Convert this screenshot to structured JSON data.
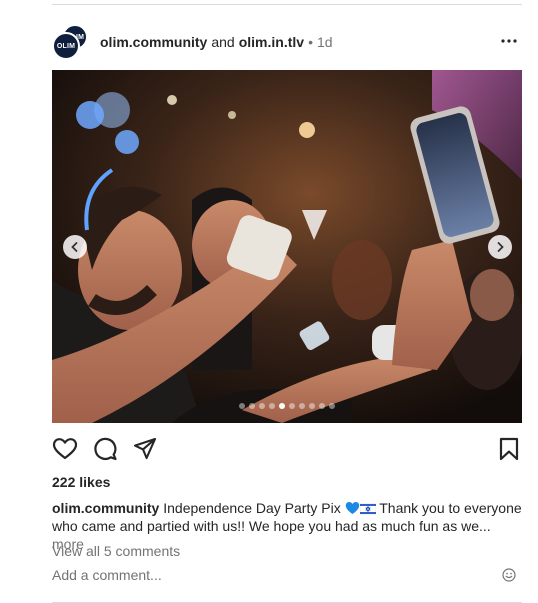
{
  "post": {
    "user1": "olim.community",
    "connector": "and",
    "user2": "olim.in.tlv",
    "separator": "•",
    "time": "1d",
    "avatar_text": "OLIM"
  },
  "carousel": {
    "total": 10,
    "active_index": 4
  },
  "likes": "222 likes",
  "caption": {
    "user": "olim.community",
    "text_before": " Independence Day Party Pix",
    "text_after": " Thank you to everyone who came and partied with us!! We hope you had as much fun as we...",
    "more": " more"
  },
  "view_comments": "View all 5 comments",
  "comment_input": {
    "placeholder": "Add a comment..."
  },
  "icons": {
    "more": "more-horizontal-icon",
    "like": "heart-icon",
    "comment": "speech-bubble-icon",
    "share": "paper-plane-icon",
    "save": "bookmark-icon",
    "emoji": "smiley-icon",
    "prev": "chevron-left-icon",
    "next": "chevron-right-icon"
  },
  "colors": {
    "heart_emoji": "#1e88e5",
    "flag_blue": "#0038b8"
  }
}
